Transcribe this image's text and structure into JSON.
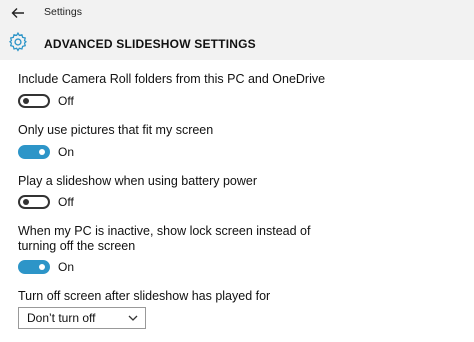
{
  "window": {
    "title": "Settings"
  },
  "header": {
    "title": "ADVANCED SLIDESHOW SETTINGS"
  },
  "settings": [
    {
      "label": "Include Camera Roll folders from this PC and OneDrive",
      "state": "Off"
    },
    {
      "label": "Only use pictures that fit my screen",
      "state": "On"
    },
    {
      "label": "Play a slideshow when using battery power",
      "state": "Off"
    },
    {
      "label": "When my PC is inactive, show lock screen instead of turning off the screen",
      "state": "On"
    }
  ],
  "screen_off": {
    "label": "Turn off screen after slideshow has played for",
    "selected": "Don’t turn off"
  },
  "colors": {
    "accent": "#2d95c8",
    "header_bg": "#f2f2f2"
  },
  "icons": {
    "back": "back-arrow-icon",
    "settings": "gear-icon",
    "dropdown": "chevron-down-icon"
  }
}
